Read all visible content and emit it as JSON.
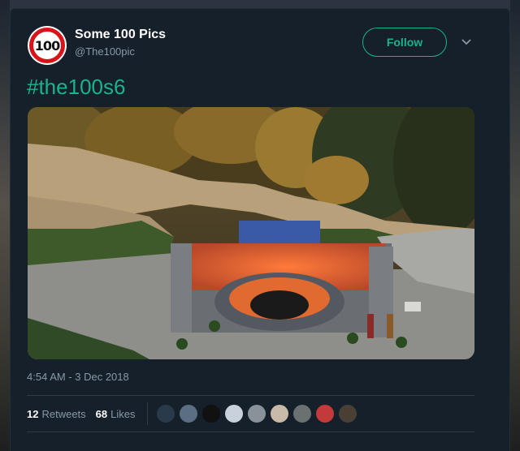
{
  "tweet": {
    "author": {
      "avatar_text": "100",
      "display_name": "Some 100 Pics",
      "handle": "@The100pic"
    },
    "follow_label": "Follow",
    "hashtag": "#the100s6",
    "timestamp": "4:54 AM - 3 Dec 2018",
    "stats": {
      "retweets_count": "12",
      "retweets_label": "Retweets",
      "likes_count": "68",
      "likes_label": "Likes"
    },
    "likers": [
      {
        "color": "#2b3a4a"
      },
      {
        "color": "#5a6f84"
      },
      {
        "color": "#111111"
      },
      {
        "color": "#c9d2dc"
      },
      {
        "color": "#8a9299"
      },
      {
        "color": "#c8b9a8"
      },
      {
        "color": "#6b7070"
      },
      {
        "color": "#c23a3a"
      },
      {
        "color": "#4a3f35"
      }
    ]
  },
  "colors": {
    "accent": "#1ab38b",
    "background": "#15202b",
    "muted_text": "#8899a6"
  }
}
